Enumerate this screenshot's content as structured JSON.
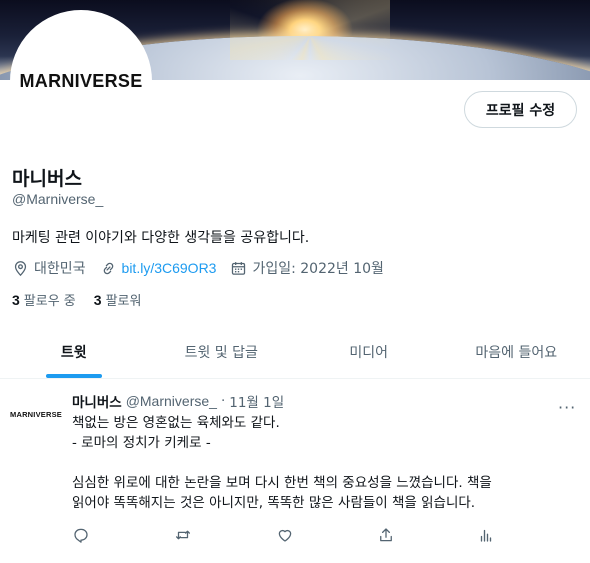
{
  "banner": {
    "description_icon": "earth-sunrise-banner"
  },
  "profile": {
    "avatar_text": "MARNIVERSE",
    "edit_button": "프로필 수정",
    "name": "마니버스",
    "handle": "@Marniverse_",
    "bio": "마케팅 관련 이야기와 다양한 생각들을 공유합니다.",
    "location": "대한민국",
    "link": "bit.ly/3C69OR3",
    "joined": "가입일: 2022년 10월",
    "following_count": "3",
    "following_label": "팔로우 중",
    "followers_count": "3",
    "followers_label": "팔로워"
  },
  "tabs": [
    {
      "label": "트윗",
      "active": true
    },
    {
      "label": "트윗 및 답글",
      "active": false
    },
    {
      "label": "미디어",
      "active": false
    },
    {
      "label": "마음에 들어요",
      "active": false
    }
  ],
  "tweet": {
    "avatar_text": "MARNIVERSE",
    "name": "마니버스",
    "handle": "@Marniverse_",
    "dot": "·",
    "date": "11월 1일",
    "more": "···",
    "lines": [
      "책없는 방은 영혼없는 육체와도 같다.",
      "- 로마의 정치가 키케로 -",
      "",
      "심심한 위로에 대한 논란을 보며 다시 한번 책의 중요성을 느꼈습니다. 책을",
      "읽어야 똑똑해지는 것은 아니지만, 똑똑한 많은 사람들이 책을 읽습니다."
    ],
    "actions": [
      "reply-icon",
      "retweet-icon",
      "like-icon",
      "share-icon",
      "analytics-icon"
    ]
  },
  "colors": {
    "accent": "#1d9bf0",
    "text": "#0f1419",
    "muted": "#536471",
    "border": "#cfd9de"
  }
}
